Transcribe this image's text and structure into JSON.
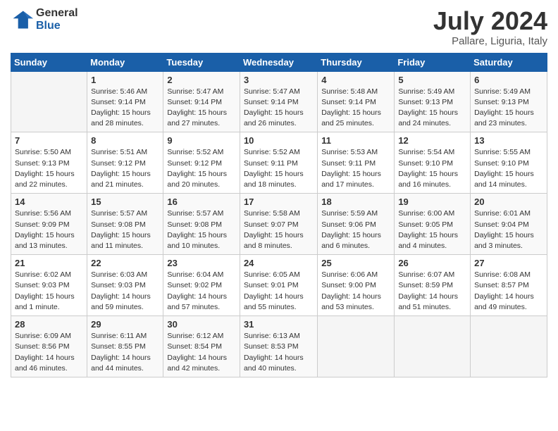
{
  "logo": {
    "general": "General",
    "blue": "Blue"
  },
  "title": "July 2024",
  "subtitle": "Pallare, Liguria, Italy",
  "weekdays": [
    "Sunday",
    "Monday",
    "Tuesday",
    "Wednesday",
    "Thursday",
    "Friday",
    "Saturday"
  ],
  "weeks": [
    [
      {
        "day": "",
        "sunrise": "",
        "sunset": "",
        "daylight": ""
      },
      {
        "day": "1",
        "sunrise": "Sunrise: 5:46 AM",
        "sunset": "Sunset: 9:14 PM",
        "daylight": "Daylight: 15 hours and 28 minutes."
      },
      {
        "day": "2",
        "sunrise": "Sunrise: 5:47 AM",
        "sunset": "Sunset: 9:14 PM",
        "daylight": "Daylight: 15 hours and 27 minutes."
      },
      {
        "day": "3",
        "sunrise": "Sunrise: 5:47 AM",
        "sunset": "Sunset: 9:14 PM",
        "daylight": "Daylight: 15 hours and 26 minutes."
      },
      {
        "day": "4",
        "sunrise": "Sunrise: 5:48 AM",
        "sunset": "Sunset: 9:14 PM",
        "daylight": "Daylight: 15 hours and 25 minutes."
      },
      {
        "day": "5",
        "sunrise": "Sunrise: 5:49 AM",
        "sunset": "Sunset: 9:13 PM",
        "daylight": "Daylight: 15 hours and 24 minutes."
      },
      {
        "day": "6",
        "sunrise": "Sunrise: 5:49 AM",
        "sunset": "Sunset: 9:13 PM",
        "daylight": "Daylight: 15 hours and 23 minutes."
      }
    ],
    [
      {
        "day": "7",
        "sunrise": "Sunrise: 5:50 AM",
        "sunset": "Sunset: 9:13 PM",
        "daylight": "Daylight: 15 hours and 22 minutes."
      },
      {
        "day": "8",
        "sunrise": "Sunrise: 5:51 AM",
        "sunset": "Sunset: 9:12 PM",
        "daylight": "Daylight: 15 hours and 21 minutes."
      },
      {
        "day": "9",
        "sunrise": "Sunrise: 5:52 AM",
        "sunset": "Sunset: 9:12 PM",
        "daylight": "Daylight: 15 hours and 20 minutes."
      },
      {
        "day": "10",
        "sunrise": "Sunrise: 5:52 AM",
        "sunset": "Sunset: 9:11 PM",
        "daylight": "Daylight: 15 hours and 18 minutes."
      },
      {
        "day": "11",
        "sunrise": "Sunrise: 5:53 AM",
        "sunset": "Sunset: 9:11 PM",
        "daylight": "Daylight: 15 hours and 17 minutes."
      },
      {
        "day": "12",
        "sunrise": "Sunrise: 5:54 AM",
        "sunset": "Sunset: 9:10 PM",
        "daylight": "Daylight: 15 hours and 16 minutes."
      },
      {
        "day": "13",
        "sunrise": "Sunrise: 5:55 AM",
        "sunset": "Sunset: 9:10 PM",
        "daylight": "Daylight: 15 hours and 14 minutes."
      }
    ],
    [
      {
        "day": "14",
        "sunrise": "Sunrise: 5:56 AM",
        "sunset": "Sunset: 9:09 PM",
        "daylight": "Daylight: 15 hours and 13 minutes."
      },
      {
        "day": "15",
        "sunrise": "Sunrise: 5:57 AM",
        "sunset": "Sunset: 9:08 PM",
        "daylight": "Daylight: 15 hours and 11 minutes."
      },
      {
        "day": "16",
        "sunrise": "Sunrise: 5:57 AM",
        "sunset": "Sunset: 9:08 PM",
        "daylight": "Daylight: 15 hours and 10 minutes."
      },
      {
        "day": "17",
        "sunrise": "Sunrise: 5:58 AM",
        "sunset": "Sunset: 9:07 PM",
        "daylight": "Daylight: 15 hours and 8 minutes."
      },
      {
        "day": "18",
        "sunrise": "Sunrise: 5:59 AM",
        "sunset": "Sunset: 9:06 PM",
        "daylight": "Daylight: 15 hours and 6 minutes."
      },
      {
        "day": "19",
        "sunrise": "Sunrise: 6:00 AM",
        "sunset": "Sunset: 9:05 PM",
        "daylight": "Daylight: 15 hours and 4 minutes."
      },
      {
        "day": "20",
        "sunrise": "Sunrise: 6:01 AM",
        "sunset": "Sunset: 9:04 PM",
        "daylight": "Daylight: 15 hours and 3 minutes."
      }
    ],
    [
      {
        "day": "21",
        "sunrise": "Sunrise: 6:02 AM",
        "sunset": "Sunset: 9:03 PM",
        "daylight": "Daylight: 15 hours and 1 minute."
      },
      {
        "day": "22",
        "sunrise": "Sunrise: 6:03 AM",
        "sunset": "Sunset: 9:03 PM",
        "daylight": "Daylight: 14 hours and 59 minutes."
      },
      {
        "day": "23",
        "sunrise": "Sunrise: 6:04 AM",
        "sunset": "Sunset: 9:02 PM",
        "daylight": "Daylight: 14 hours and 57 minutes."
      },
      {
        "day": "24",
        "sunrise": "Sunrise: 6:05 AM",
        "sunset": "Sunset: 9:01 PM",
        "daylight": "Daylight: 14 hours and 55 minutes."
      },
      {
        "day": "25",
        "sunrise": "Sunrise: 6:06 AM",
        "sunset": "Sunset: 9:00 PM",
        "daylight": "Daylight: 14 hours and 53 minutes."
      },
      {
        "day": "26",
        "sunrise": "Sunrise: 6:07 AM",
        "sunset": "Sunset: 8:59 PM",
        "daylight": "Daylight: 14 hours and 51 minutes."
      },
      {
        "day": "27",
        "sunrise": "Sunrise: 6:08 AM",
        "sunset": "Sunset: 8:57 PM",
        "daylight": "Daylight: 14 hours and 49 minutes."
      }
    ],
    [
      {
        "day": "28",
        "sunrise": "Sunrise: 6:09 AM",
        "sunset": "Sunset: 8:56 PM",
        "daylight": "Daylight: 14 hours and 46 minutes."
      },
      {
        "day": "29",
        "sunrise": "Sunrise: 6:11 AM",
        "sunset": "Sunset: 8:55 PM",
        "daylight": "Daylight: 14 hours and 44 minutes."
      },
      {
        "day": "30",
        "sunrise": "Sunrise: 6:12 AM",
        "sunset": "Sunset: 8:54 PM",
        "daylight": "Daylight: 14 hours and 42 minutes."
      },
      {
        "day": "31",
        "sunrise": "Sunrise: 6:13 AM",
        "sunset": "Sunset: 8:53 PM",
        "daylight": "Daylight: 14 hours and 40 minutes."
      },
      {
        "day": "",
        "sunrise": "",
        "sunset": "",
        "daylight": ""
      },
      {
        "day": "",
        "sunrise": "",
        "sunset": "",
        "daylight": ""
      },
      {
        "day": "",
        "sunrise": "",
        "sunset": "",
        "daylight": ""
      }
    ]
  ]
}
